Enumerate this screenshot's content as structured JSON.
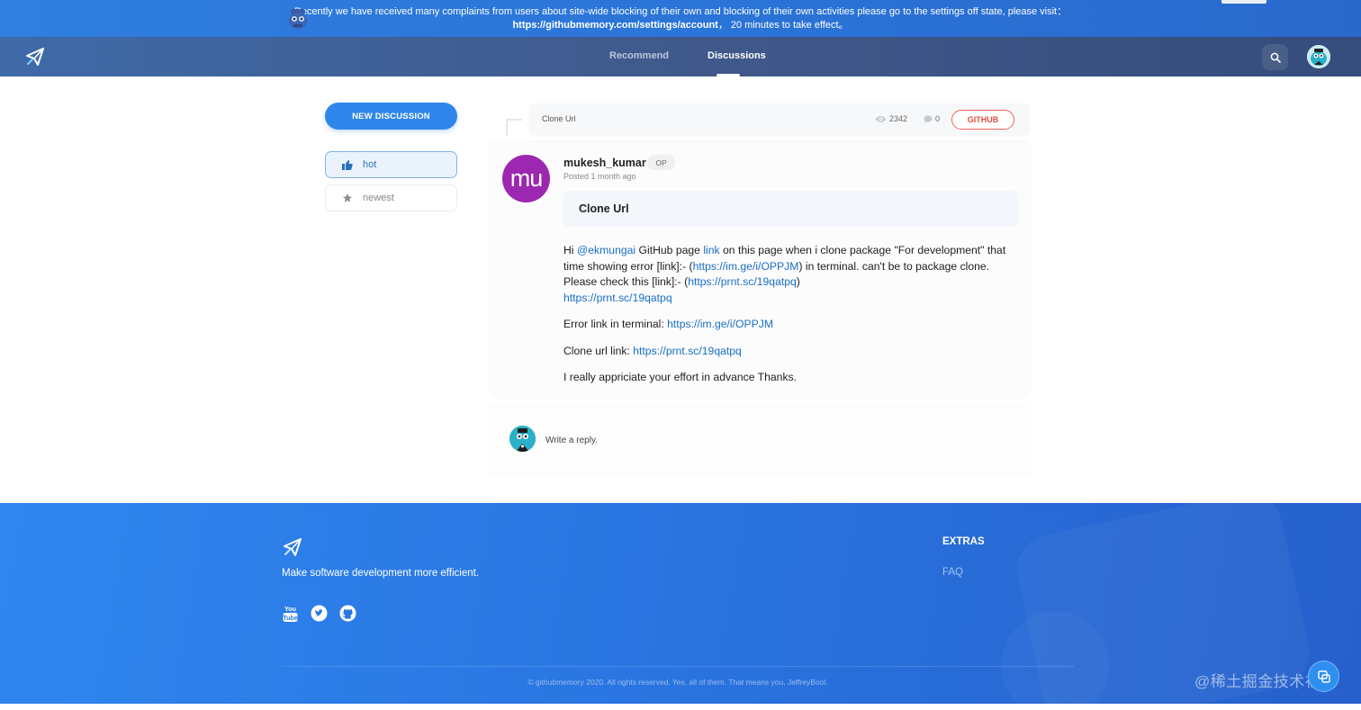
{
  "banner": {
    "line1": "Recently we have received many complaints from users about site-wide blocking of their own and blocking of their own activities please go to the settings off state, please visit：",
    "link": "https://githubmemory.com/settings/account",
    "line2_rest": "，  20 minutes to take effect。"
  },
  "nav": {
    "tabs": [
      "Recommend",
      "Discussions"
    ],
    "active_tab": "Discussions"
  },
  "sidebar": {
    "new_discussion_label": "NEW DISCUSSION",
    "filters": [
      {
        "label": "hot",
        "icon": "hot-icon",
        "active": true
      },
      {
        "label": "newest",
        "icon": "star-icon",
        "active": false
      }
    ]
  },
  "thread": {
    "title": "Clone Url",
    "views": "2342",
    "comments": "0",
    "github_label": "GITHUB"
  },
  "post": {
    "avatar_initials": "mu",
    "author": "mukesh_kumar",
    "badge": "OP",
    "posted": "Posted 1 month ago",
    "title": "Clone Url",
    "p1": {
      "t1": "Hi ",
      "mention": "@ekmungai",
      "t2": " GitHub page ",
      "link": "link",
      "t3": " on this page when i clone package \"For development\" that time showing error [link]:- (",
      "url1": "https://im.ge/i/OPPJM",
      "t4": ") in terminal. can't be to package clone. Please check this [link]:- (",
      "url2": "https://prnt.sc/19qatpq",
      "t5": ")",
      "url3": "https://prnt.sc/19qatpq"
    },
    "p2": {
      "label": "Error link in terminal: ",
      "url": "https://im.ge/i/OPPJM"
    },
    "p3": {
      "label": "Clone url link: ",
      "url": "https://prnt.sc/19qatpq"
    },
    "p4": "I really appriciate your effort in advance Thanks."
  },
  "reply": {
    "placeholder": "Write a reply."
  },
  "footer": {
    "tagline": "Make software development more efficient.",
    "social": [
      "youtube-icon",
      "twitter-icon",
      "github-icon"
    ],
    "extras_title": "EXTRAS",
    "faq": "FAQ",
    "copyright": "© githubmemory 2020. All rights reserved. Yes, all of them. That means you, JeffreyBool.",
    "watermark": "@稀土掘金技术社区"
  },
  "colors": {
    "accent": "#2f86ea",
    "github_red": "#e0503f",
    "avatar_purple": "#9c27b0",
    "link": "#1a6fc4"
  }
}
